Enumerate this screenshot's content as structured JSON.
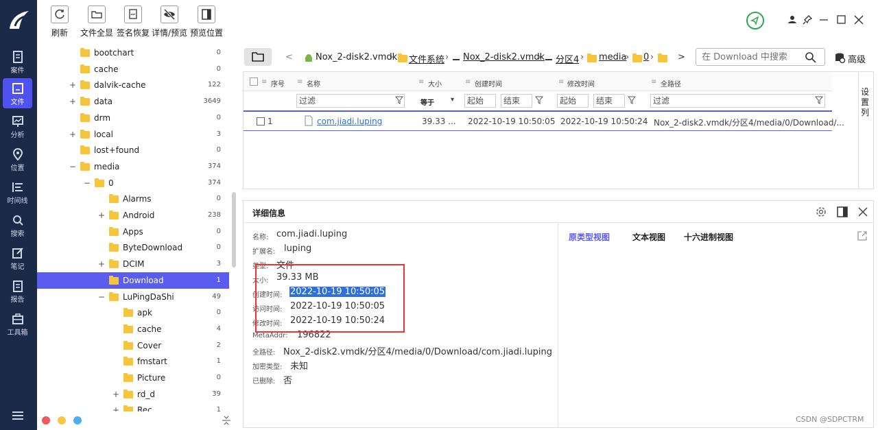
{
  "nav": {
    "items": [
      {
        "label": "案件",
        "icon": "case-icon"
      },
      {
        "label": "文件",
        "icon": "file-icon",
        "active": true
      },
      {
        "label": "分析",
        "icon": "analysis-icon"
      },
      {
        "label": "位置",
        "icon": "location-icon"
      },
      {
        "label": "时间线",
        "icon": "timeline-icon"
      },
      {
        "label": "搜索",
        "icon": "search-icon"
      },
      {
        "label": "笔记",
        "icon": "note-icon"
      },
      {
        "label": "报告",
        "icon": "report-icon"
      },
      {
        "label": "工具箱",
        "icon": "toolbox-icon"
      }
    ]
  },
  "toolbar": {
    "refresh": "刷新",
    "expand_all": "文件全显",
    "sign_restore": "签名恢复",
    "detail_preview": "详情/预览",
    "preview_pos": "预览位置"
  },
  "tree": {
    "rows": [
      {
        "name": "bootchart",
        "count": "0"
      },
      {
        "name": "cache",
        "count": "0"
      },
      {
        "name": "dalvik-cache",
        "count": "122",
        "exp": "+"
      },
      {
        "name": "data",
        "count": "3649",
        "exp": "+"
      },
      {
        "name": "drm",
        "count": "0"
      },
      {
        "name": "local",
        "count": "3",
        "exp": "+"
      },
      {
        "name": "lost+found",
        "count": "0"
      },
      {
        "name": "media",
        "count": "374",
        "exp": "−"
      },
      {
        "name": "0",
        "count": "374",
        "exp": "−"
      },
      {
        "name": "Alarms",
        "count": "0"
      },
      {
        "name": "Android",
        "count": "238",
        "exp": "+"
      },
      {
        "name": "Apps",
        "count": "0"
      },
      {
        "name": "ByteDownload",
        "count": "0"
      },
      {
        "name": "DCIM",
        "count": "3",
        "exp": "+"
      },
      {
        "name": "Download",
        "count": "1",
        "selected": true
      },
      {
        "name": "LuPingDaShi",
        "count": "49",
        "exp": "−"
      },
      {
        "name": "apk",
        "count": "0"
      },
      {
        "name": "cache",
        "count": "4"
      },
      {
        "name": "Cover",
        "count": "2"
      },
      {
        "name": "fmstart",
        "count": "1"
      },
      {
        "name": "Picture",
        "count": "0"
      },
      {
        "name": "rd_d",
        "count": "39",
        "exp": "+"
      },
      {
        "name": "Rec",
        "count": "1",
        "exp": "+"
      }
    ]
  },
  "path": {
    "crumbs": [
      "Nox_2-disk2.vmdk",
      "文件系统",
      "Nox_2-disk2.vmdk",
      "分区4",
      "media",
      "0"
    ],
    "search_placeholder": "在 Download 中搜索",
    "advanced": "高级"
  },
  "grid": {
    "headers": [
      "序号",
      "名称",
      "大小",
      "创建时间",
      "修改时间",
      "全路径"
    ],
    "filter": "过滤",
    "equals": "等于",
    "start": "起始",
    "end": "结束",
    "set_columns": "设置列",
    "row": {
      "index": "1",
      "name": "com.jiadi.luping",
      "size": "39.33 ...",
      "created": "2022-10-19 10:50:05",
      "modified": "2022-10-19 10:50:24",
      "path": "Nox_2-disk2.vmdk/分区4/media/0/Download/..."
    }
  },
  "detail": {
    "title": "详细信息",
    "labels": {
      "name": "名称:",
      "ext": "扩展名:",
      "type": "类型:",
      "size": "大小:",
      "created": "创建时间:",
      "accessed": "访问时间:",
      "modified": "修改时间:",
      "meta": "MetaAddr:",
      "fullpath": "全路径:",
      "encrypt": "加密类型:",
      "deleted": "已删除:"
    },
    "values": {
      "name": "com.jiadi.luping",
      "ext": "luping",
      "type": "文件",
      "size": "39.33 MB",
      "created": "2022-10-19 10:50:05",
      "accessed": "2022-10-19 10:50:05",
      "modified": "2022-10-19 10:50:24",
      "meta": "196822",
      "fullpath": "Nox_2-disk2.vmdk/分区4/media/0/Download/com.jiadi.luping",
      "encrypt": "未知",
      "deleted": "否"
    },
    "tabs": [
      "原类型视图",
      "文本视图",
      "十六进制视图"
    ]
  },
  "watermark": "CSDN @SDPCTRM",
  "colors": {
    "accent": "#5b5cf0",
    "nav_bg": "#1c2a4a",
    "highlight_box": "#e33"
  }
}
